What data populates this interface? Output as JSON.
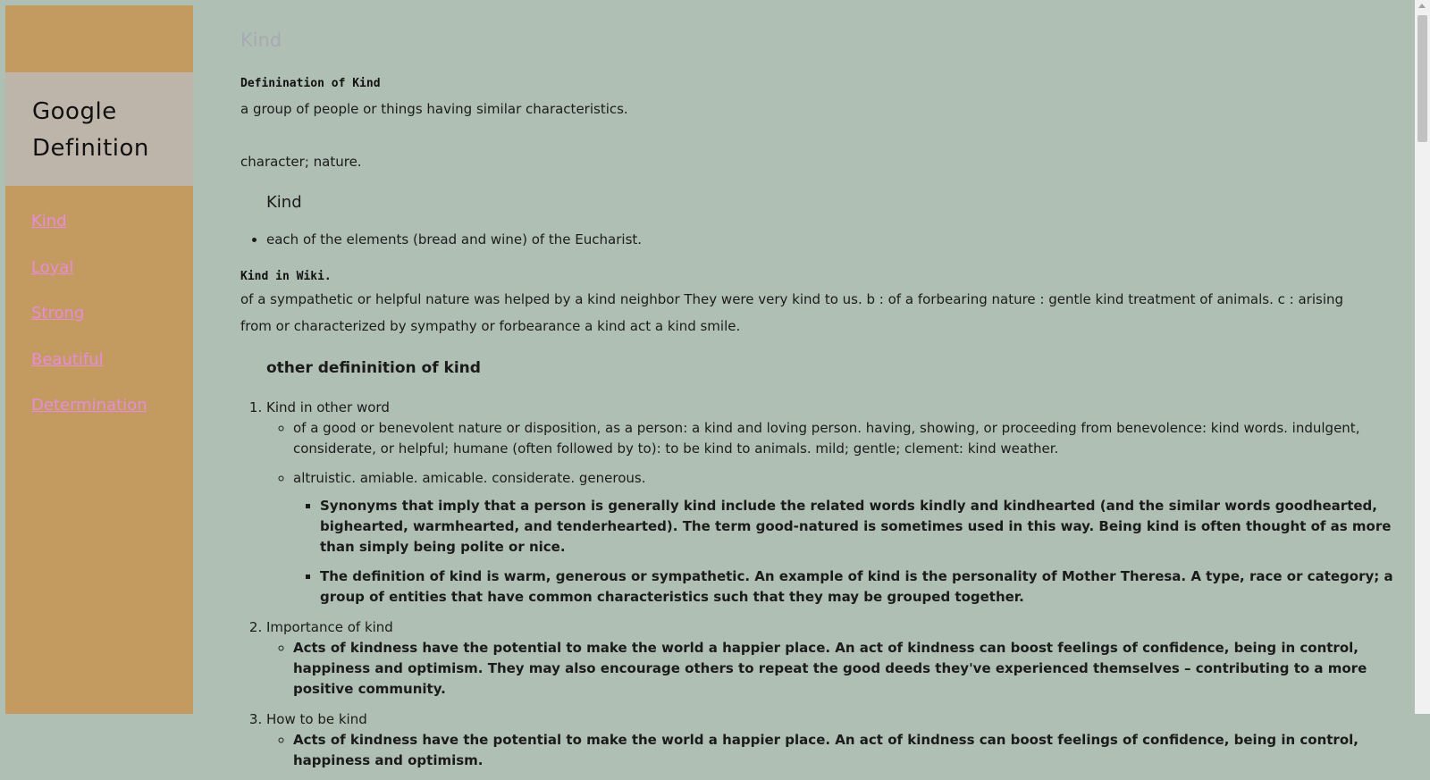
{
  "sidebar": {
    "brand": [
      "Google",
      "Definition"
    ],
    "nav": [
      {
        "label": "Kind"
      },
      {
        "label": "Loyal"
      },
      {
        "label": "Strong"
      },
      {
        "label": "Beautiful"
      },
      {
        "label": "Determination"
      }
    ]
  },
  "main": {
    "title": "Kind",
    "def_heading": "Definination of Kind",
    "def_text": "a group of people or things having similar characteristics.",
    "def_text2": "character; nature.",
    "sub_heading": "Kind",
    "bullet1": "each of the elements (bread and wine) of the Eucharist.",
    "wiki_heading": "Kind in Wiki.",
    "wiki_text": "of a sympathetic or helpful nature was helped by a kind neighbor They were very kind to us. b : of a forbearing nature : gentle kind treatment of animals. c : arising from or characterized by sympathy or forbearance a kind act a kind smile.",
    "other_heading": "other defininition of kind",
    "sections": [
      {
        "title": "Kind in other word",
        "items": [
          {
            "text": "of a good or benevolent nature or disposition, as a person: a kind and loving person. having, showing, or proceeding from benevolence: kind words. indulgent, considerate, or helpful; humane (often followed by to): to be kind to animals. mild; gentle; clement: kind weather."
          },
          {
            "text": "altruistic. amiable. amicable. considerate. generous.",
            "sub": [
              "Synonyms that imply that a person is generally kind include the related words kindly and kindhearted (and the similar words goodhearted, bighearted, warmhearted, and tenderhearted). The term good-natured is sometimes used in this way. Being kind is often thought of as more than simply being polite or nice.",
              "The definition of kind is warm, generous or sympathetic. An example of kind is the personality of Mother Theresa. A type, race or category; a group of entities that have common characteristics such that they may be grouped together."
            ]
          }
        ]
      },
      {
        "title": "Importance of kind",
        "items": [
          {
            "text": "Acts of kindness have the potential to make the world a happier place. An act of kindness can boost feelings of confidence, being in control, happiness and optimism. They may also encourage others to repeat the good deeds they've experienced themselves – contributing to a more positive community."
          }
        ]
      },
      {
        "title": "How to be kind",
        "items": [
          {
            "text": "Acts of kindness have the potential to make the world a happier place. An act of kindness can boost feelings of confidence, being in control, happiness and optimism."
          }
        ]
      }
    ]
  }
}
